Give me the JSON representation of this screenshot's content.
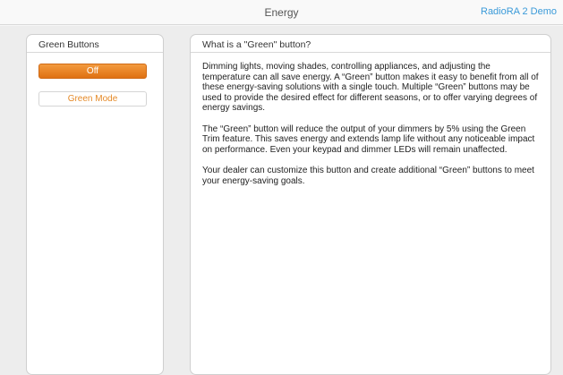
{
  "header": {
    "title": "Energy",
    "demo_link": "RadioRA 2 Demo"
  },
  "left_panel": {
    "title": "Green Buttons",
    "buttons": [
      {
        "label": "Off",
        "state": "active",
        "color": "#e67e22"
      },
      {
        "label": "Green Mode",
        "state": "inactive"
      }
    ]
  },
  "right_panel": {
    "title": "What is a \"Green\" button?",
    "paragraphs": [
      "Dimming lights, moving shades, controlling appliances, and adjusting the temperature can all save energy. A “Green” button makes it easy to benefit from all of these energy-saving solutions with a single touch. Multiple “Green” buttons may be used to provide the desired effect for different seasons, or to offer varying degrees of energy savings.",
      "The “Green” button will reduce the output of your dimmers by 5% using the Green Trim feature. This saves energy and extends lamp life without any noticeable impact on performance. Even your keypad and dimmer LEDs will remain unaffected.",
      "Your dealer can customize this button and create additional “Green” buttons to meet your energy-saving goals."
    ]
  },
  "colors": {
    "accent_orange": "#e67e22",
    "link_blue": "#3a9ad9"
  }
}
